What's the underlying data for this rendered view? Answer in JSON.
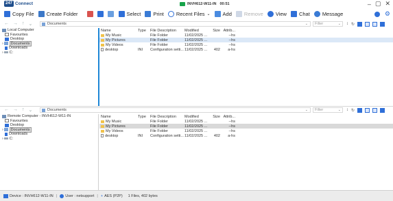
{
  "app": {
    "badge": "247",
    "name": "Connect"
  },
  "session": {
    "computer": "INVH612-W11-IN",
    "timer": "00:51"
  },
  "toolbar": {
    "copy_file": "Copy File",
    "create_folder": "Create Folder",
    "select": "Select",
    "print": "Print",
    "recent_files": "Recent Files",
    "add": "Add",
    "remove": "Remove",
    "view": "View",
    "chat": "Chat",
    "message": "Message"
  },
  "top": {
    "path": "Documents",
    "filter_placeholder": "Filter",
    "tree": [
      {
        "label": "Local Computer"
      },
      {
        "label": "Favourites"
      },
      {
        "label": "Desktop"
      },
      {
        "label": "Documents"
      },
      {
        "label": "Downloads"
      },
      {
        "label": "C:"
      }
    ],
    "columns": {
      "name": "Name",
      "type": "Type",
      "desc": "File Description",
      "modified": "Modified",
      "size": "Size",
      "attr": "Attrib..."
    },
    "rows": [
      {
        "name": "My Music",
        "type": "",
        "desc": "File Folder",
        "modified": "11/02/2025 ...",
        "size": "",
        "attr": "--hs"
      },
      {
        "name": "My Pictures",
        "type": "",
        "desc": "File Folder",
        "modified": "11/02/2025 ...",
        "size": "",
        "attr": "--hs"
      },
      {
        "name": "My Videos",
        "type": "",
        "desc": "File Folder",
        "modified": "11/02/2025 ...",
        "size": "",
        "attr": "--hs"
      },
      {
        "name": "desktop",
        "type": "INI",
        "desc": "Configuration setti...",
        "modified": "11/02/2025 ...",
        "size": "402",
        "attr": "a-hs"
      }
    ]
  },
  "bottom": {
    "path": "Documents",
    "filter_placeholder": "Filter",
    "tree": [
      {
        "label": "Remote Computer - INVH612-W11-IN"
      },
      {
        "label": "Favourites"
      },
      {
        "label": "Desktop"
      },
      {
        "label": "Documents"
      },
      {
        "label": "Downloads"
      },
      {
        "label": "C:"
      }
    ],
    "columns": {
      "name": "Name",
      "type": "Type",
      "desc": "File Description",
      "modified": "Modified",
      "size": "Size",
      "attr": "Attrib..."
    },
    "rows": [
      {
        "name": "My Music",
        "type": "",
        "desc": "File Folder",
        "modified": "11/02/2025 ...",
        "size": "",
        "attr": "--hs"
      },
      {
        "name": "My Pictures",
        "type": "",
        "desc": "File Folder",
        "modified": "11/02/2025 ...",
        "size": "",
        "attr": "--hs"
      },
      {
        "name": "My Videos",
        "type": "",
        "desc": "File Folder",
        "modified": "11/02/2025 ...",
        "size": "",
        "attr": "--hs"
      },
      {
        "name": "desktop",
        "type": "INI",
        "desc": "Configuration setti...",
        "modified": "11/02/2025 ...",
        "size": "402",
        "attr": "a-hs"
      }
    ]
  },
  "status": {
    "device": "Device : INVH612-W11-IN",
    "user": "User : netsupport",
    "encryption": "AES (P2P)",
    "summary": "1 Files, 402 bytes"
  },
  "colors": {
    "accent": "#2f6fd8",
    "divider_active": "#1e86d6",
    "folder": "#f0c24b",
    "session_monitor": "#17a34a"
  }
}
